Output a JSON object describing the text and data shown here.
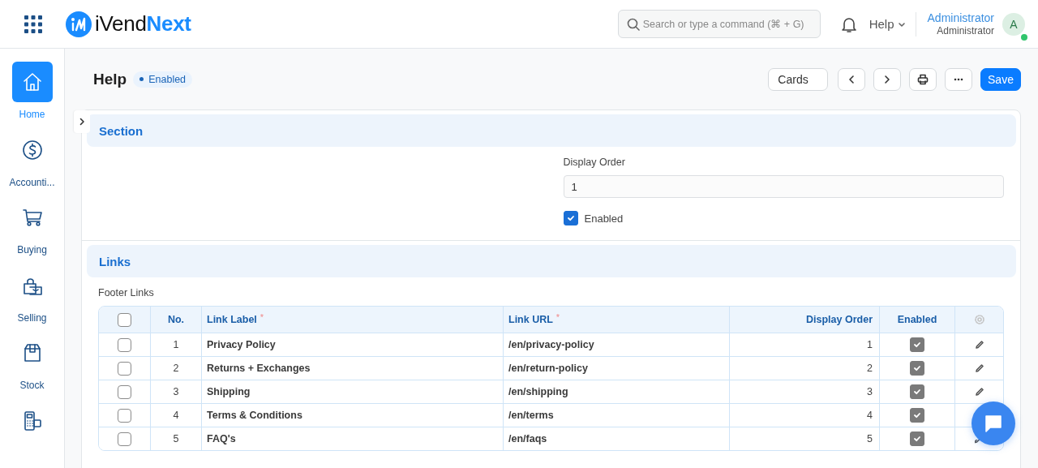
{
  "app": {
    "logo_text": "iVend",
    "logo_accent": "Next"
  },
  "search": {
    "placeholder": "Search or type a command (⌘ + G)"
  },
  "help_menu": {
    "label": "Help"
  },
  "user": {
    "name": "Administrator",
    "role": "Administrator",
    "avatar": "A",
    "online": true
  },
  "sidebar": {
    "items": [
      {
        "label": "Home",
        "selected": true
      },
      {
        "label": "Accounti...",
        "selected": false
      },
      {
        "label": "Buying",
        "selected": false
      },
      {
        "label": "Selling",
        "selected": false
      },
      {
        "label": "Stock",
        "selected": false
      },
      {
        "selected": false
      }
    ]
  },
  "page": {
    "title": "Help",
    "status": "Enabled",
    "view_select": "Cards",
    "save": "Save"
  },
  "section": {
    "title": "Section",
    "display_order": {
      "label": "Display Order",
      "value": "1"
    },
    "enabled": {
      "label": "Enabled",
      "checked": true
    }
  },
  "links": {
    "title": "Links",
    "table_label": "Footer Links",
    "all_selected": false,
    "columns": [
      {
        "label": "No."
      },
      {
        "label": "Link Label",
        "marker": "*"
      },
      {
        "label": "Link URL",
        "marker": "*"
      },
      {
        "label": "Display Order"
      },
      {
        "label": "Enabled"
      }
    ],
    "rows": [
      {
        "no": "1",
        "label": "Privacy Policy",
        "url": "/en/privacy-policy",
        "order": "1",
        "enabled": true,
        "selected": false
      },
      {
        "no": "2",
        "label": "Returns + Exchanges",
        "url": "/en/return-policy",
        "order": "2",
        "enabled": true,
        "selected": false
      },
      {
        "no": "3",
        "label": "Shipping",
        "url": "/en/shipping",
        "order": "3",
        "enabled": true,
        "selected": false
      },
      {
        "no": "4",
        "label": "Terms & Conditions",
        "url": "/en/terms",
        "order": "4",
        "enabled": true,
        "selected": false
      },
      {
        "no": "5",
        "label": "FAQ's",
        "url": "/en/faqs",
        "order": "5",
        "enabled": true,
        "selected": false
      }
    ]
  }
}
